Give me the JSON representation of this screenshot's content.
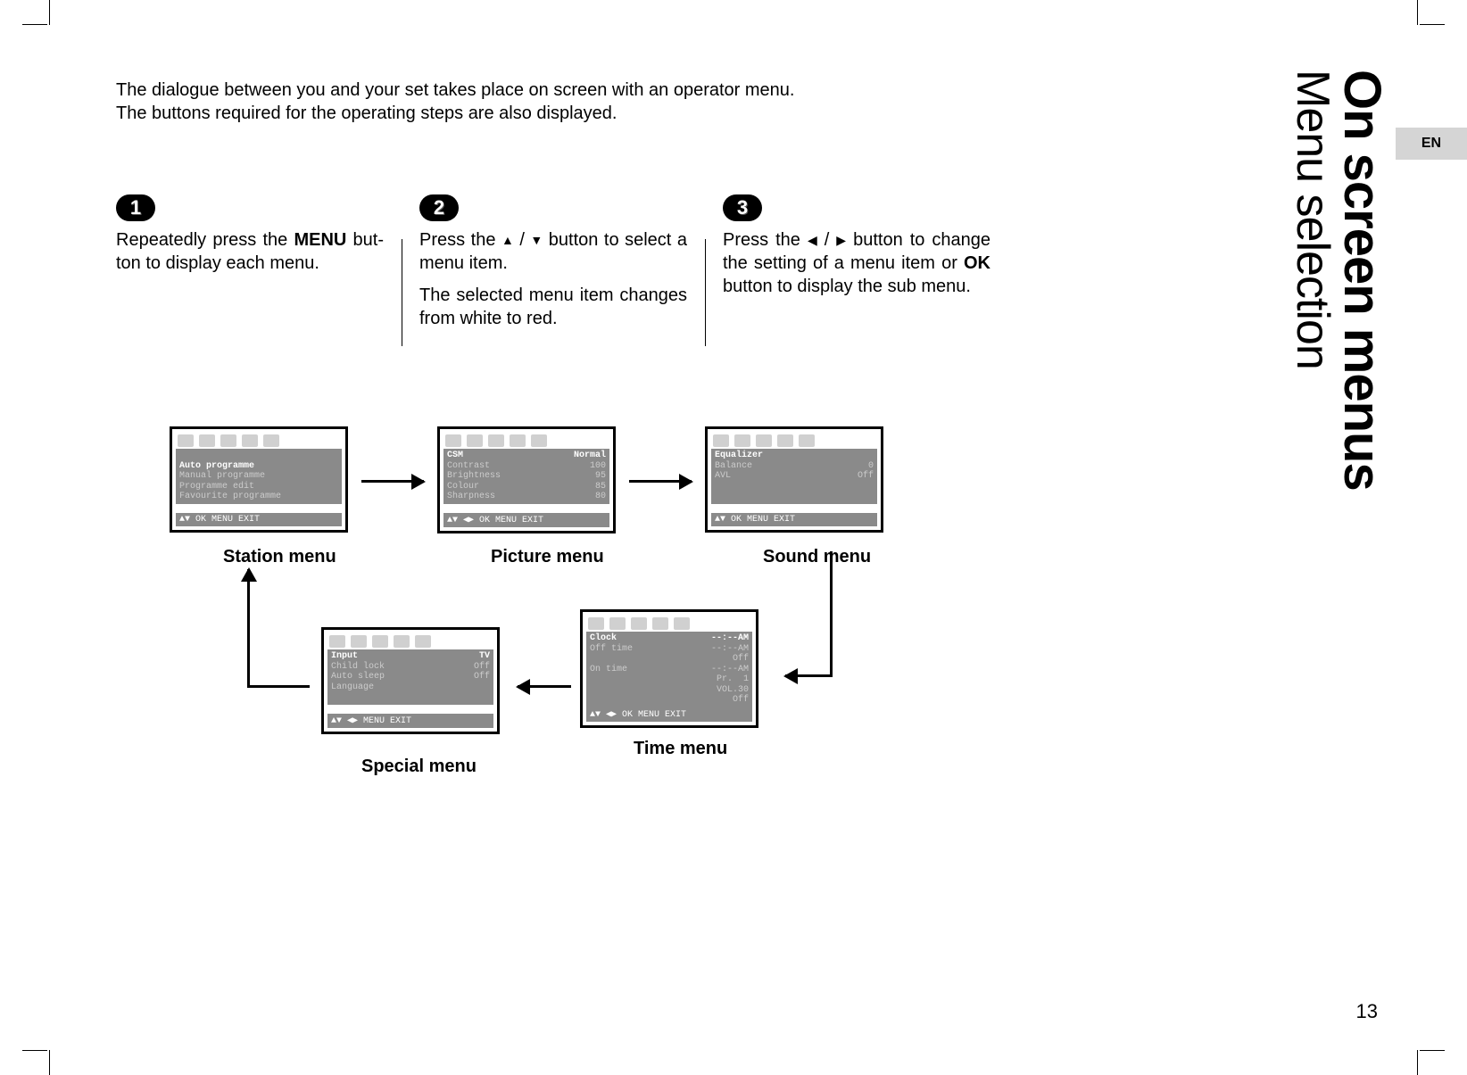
{
  "lang": "EN",
  "title_main": "On screen menus",
  "title_sub": "Menu selection",
  "intro_line1": "The dialogue between you and your set takes place on screen with an operator menu.",
  "intro_line2": "The buttons required for the operating steps are also displayed.",
  "steps": {
    "s1": {
      "num": "1",
      "text_a": "Repeatedly press the ",
      "bold": "MENU",
      "text_b": " but­ton to display each menu."
    },
    "s2": {
      "num": "2",
      "p1a": "Press the ",
      "p1b": " button to select a menu item.",
      "p2": "The selected menu item changes from white to red."
    },
    "s3": {
      "num": "3",
      "p1a": "Press the ",
      "p1b": " button to change the setting of a menu item or ",
      "bold": "OK",
      "p1c": " button to display the sub menu."
    }
  },
  "glyphs": {
    "up": "▲",
    "down": "▼",
    "left": "◀",
    "right": "▶",
    "slash": " / ",
    "updown": "▲▼",
    "leftright": "◀▶"
  },
  "menus": {
    "station": {
      "label": "Station menu",
      "items": [
        "Auto programme",
        "Manual programme",
        "Programme edit",
        "Favourite programme"
      ],
      "footer": "▲▼ OK MENU EXIT"
    },
    "picture": {
      "label": "Picture menu",
      "rows": [
        {
          "k": "CSM",
          "v": "Normal",
          "hl": true
        },
        {
          "k": "Contrast",
          "v": "100"
        },
        {
          "k": "Brightness",
          "v": "95"
        },
        {
          "k": "Colour",
          "v": "85"
        },
        {
          "k": "Sharpness",
          "v": "80"
        }
      ],
      "footer": "▲▼ ◀▶ OK MENU EXIT"
    },
    "sound": {
      "label": "Sound menu",
      "rows": [
        {
          "k": "Equalizer",
          "v": "",
          "hl": true
        },
        {
          "k": "Balance",
          "v": "0"
        },
        {
          "k": "AVL",
          "v": "Off"
        }
      ],
      "footer": "▲▼ OK MENU EXIT"
    },
    "time": {
      "label": "Time menu",
      "rows": [
        {
          "k": "Clock",
          "v": "--:--AM",
          "hl": true
        },
        {
          "k": "Off time",
          "v": "--:--AM"
        },
        {
          "k": "",
          "v": "Off"
        },
        {
          "k": "On time",
          "v": "--:--AM"
        },
        {
          "k": "",
          "v": "Pr.  1"
        },
        {
          "k": "",
          "v": "VOL.30"
        },
        {
          "k": "",
          "v": "Off"
        }
      ],
      "footer": "▲▼ ◀▶ OK MENU EXIT"
    },
    "special": {
      "label": "Special menu",
      "rows": [
        {
          "k": "Input",
          "v": "TV",
          "hl": true
        },
        {
          "k": "Child lock",
          "v": "Off"
        },
        {
          "k": "Auto sleep",
          "v": "Off"
        },
        {
          "k": "Language",
          "v": ""
        }
      ],
      "footer": "▲▼ ◀▶ MENU EXIT"
    }
  },
  "page_number": "13"
}
